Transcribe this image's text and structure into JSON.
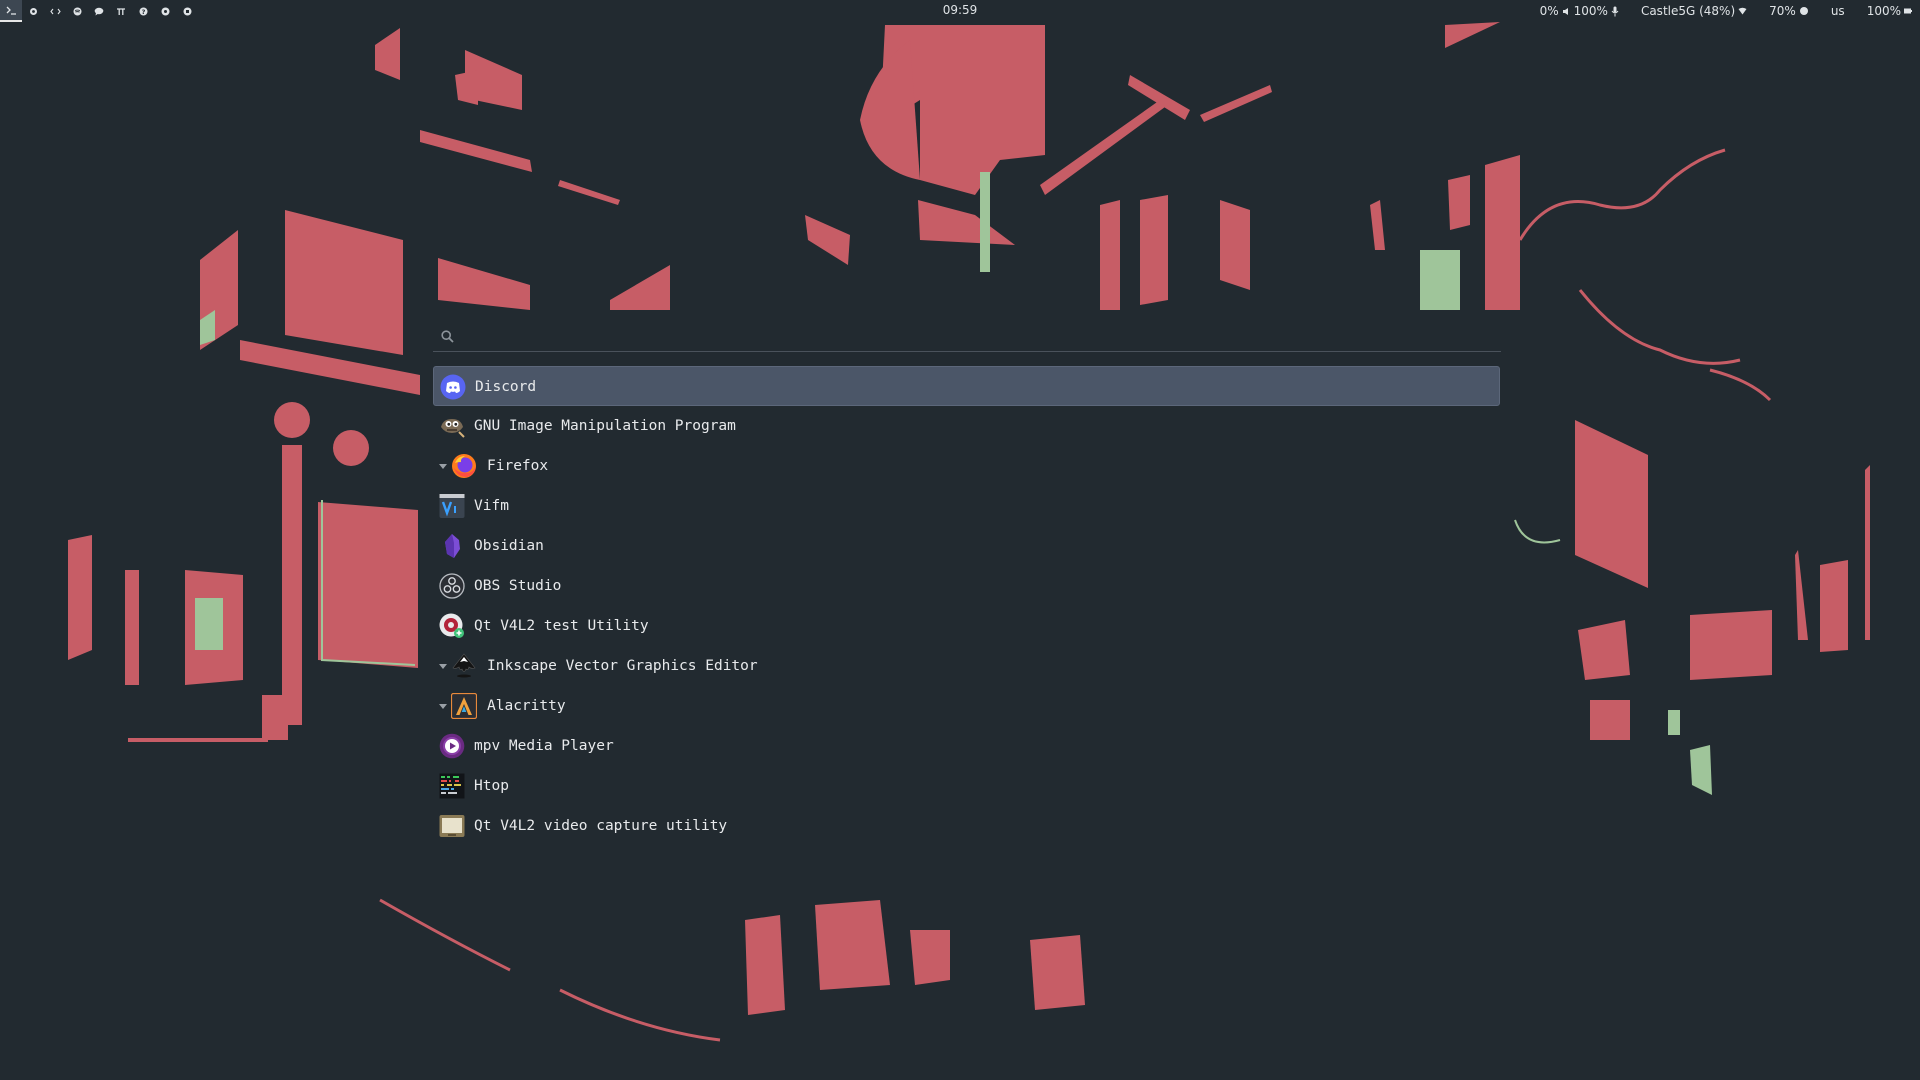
{
  "topbar": {
    "workspaces": [
      {
        "name": "terminal",
        "icon": "terminal-icon",
        "active": true
      },
      {
        "name": "settings",
        "icon": "gear-icon",
        "active": false
      },
      {
        "name": "code",
        "icon": "code-icon",
        "active": false
      },
      {
        "name": "music",
        "icon": "spotify-icon",
        "active": false
      },
      {
        "name": "chat",
        "icon": "chat-bubble-icon",
        "active": false
      },
      {
        "name": "pi",
        "icon": "pi-icon",
        "active": false
      },
      {
        "name": "help",
        "icon": "question-icon",
        "active": false
      },
      {
        "name": "media",
        "icon": "circle-icon",
        "active": false
      },
      {
        "name": "misc",
        "icon": "circle-icon",
        "active": false
      }
    ],
    "clock": "09:59",
    "status": {
      "cpu": "0%",
      "volume": "100%",
      "mic_icon": "microphone-icon",
      "wifi": "Castle5G (48%)",
      "wifi_icon": "wifi-icon",
      "brightness": "70%",
      "brightness_icon": "brightness-icon",
      "keyboard_layout": "us",
      "battery": "100%",
      "battery_icon": "battery-icon"
    }
  },
  "launcher": {
    "search": {
      "value": "",
      "placeholder": ""
    },
    "items": [
      {
        "label": "Discord",
        "icon": "discord-icon",
        "selected": true,
        "expandable": false
      },
      {
        "label": "GNU Image Manipulation Program",
        "icon": "gimp-icon",
        "selected": false,
        "expandable": false
      },
      {
        "label": "Firefox",
        "icon": "firefox-icon",
        "selected": false,
        "expandable": true
      },
      {
        "label": "Vifm",
        "icon": "vifm-icon",
        "selected": false,
        "expandable": false
      },
      {
        "label": "Obsidian",
        "icon": "obsidian-icon",
        "selected": false,
        "expandable": false
      },
      {
        "label": "OBS Studio",
        "icon": "obs-icon",
        "selected": false,
        "expandable": false
      },
      {
        "label": "Qt V4L2 test Utility",
        "icon": "qv4l2-icon",
        "selected": false,
        "expandable": false
      },
      {
        "label": "Inkscape Vector Graphics Editor",
        "icon": "inkscape-icon",
        "selected": false,
        "expandable": true
      },
      {
        "label": "Alacritty",
        "icon": "alacritty-icon",
        "selected": false,
        "expandable": true
      },
      {
        "label": "mpv Media Player",
        "icon": "mpv-icon",
        "selected": false,
        "expandable": false
      },
      {
        "label": "Htop",
        "icon": "htop-icon",
        "selected": false,
        "expandable": false
      },
      {
        "label": "Qt V4L2 video capture utility",
        "icon": "qvidcap-icon",
        "selected": false,
        "expandable": false
      }
    ]
  },
  "colors": {
    "background": "#222a30",
    "wallpaper_red": "#c75d66",
    "wallpaper_green": "#9fc59a",
    "selection": "#4b5668",
    "text": "#e8eaec"
  }
}
